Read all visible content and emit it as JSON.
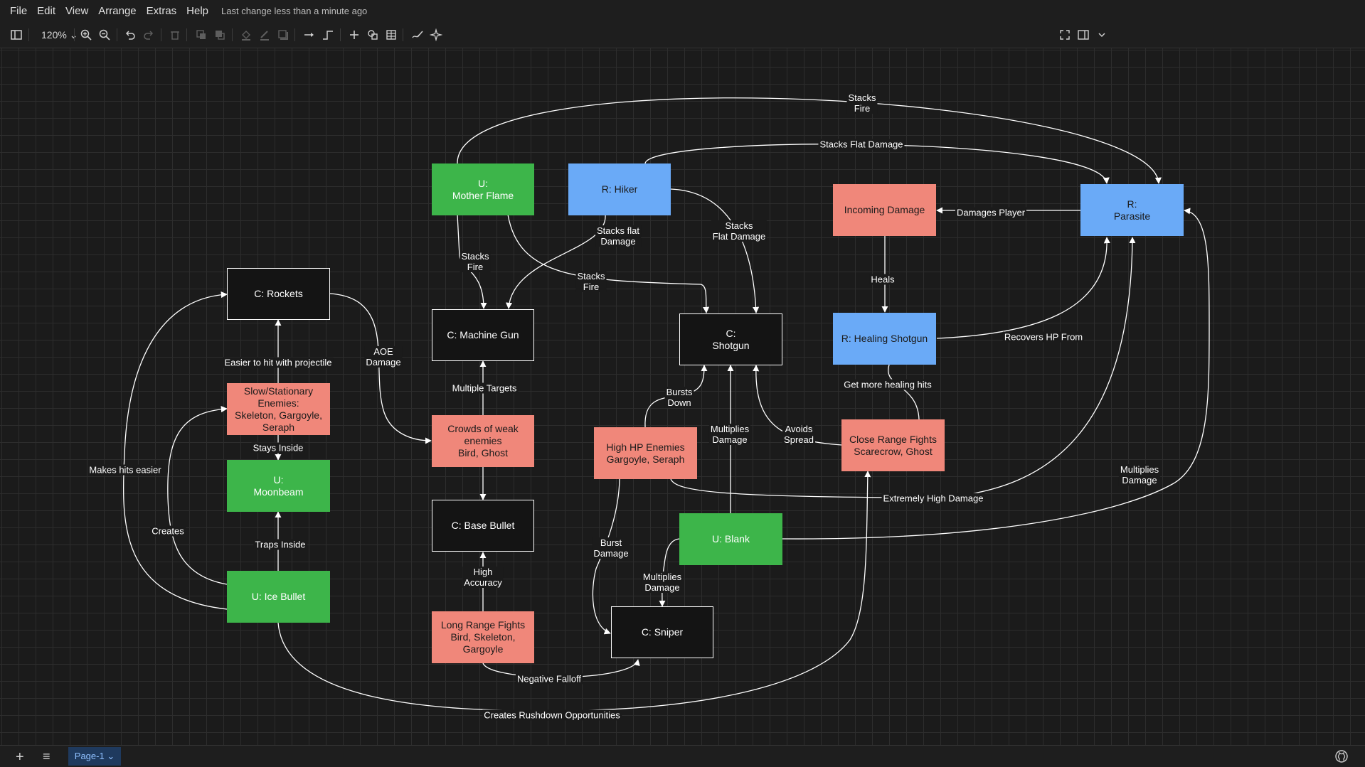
{
  "menubar": {
    "items": [
      "File",
      "Edit",
      "View",
      "Arrange",
      "Extras",
      "Help"
    ],
    "status": "Last change less than a minute ago"
  },
  "toolbar": {
    "zoom_value": "120%"
  },
  "colors": {
    "green": "#3db54a",
    "blue": "#6aaaf7",
    "salmon": "#f0877a",
    "black_node": "#141414",
    "background": "#1b1b1b"
  },
  "nodes": {
    "mother_flame": "U:\nMother Flame",
    "hiker": "R: Hiker",
    "incoming_damage": "Incoming Damage",
    "parasite": "R:\nParasite",
    "rockets": "C: Rockets",
    "machine_gun": "C: Machine Gun",
    "shotgun": "C:\nShotgun",
    "healing_shotgun": "R: Healing Shotgun",
    "slow_enemies": "Slow/Stationary\nEnemies:\nSkeleton, Gargoyle,\nSeraph",
    "crowds": "Crowds of weak\nenemies\nBird, Ghost",
    "high_hp": "High HP Enemies\nGargoyle, Seraph",
    "close_range": "Close Range Fights\nScarecrow, Ghost",
    "moonbeam": "U:\nMoonbeam",
    "base_bullet": "C: Base Bullet",
    "blank": "U: Blank",
    "ice_bullet": "U: Ice Bullet",
    "long_range": "Long Range Fights\nBird, Skeleton,\nGargoyle",
    "sniper": "C: Sniper"
  },
  "edge_labels": {
    "stacks_fire_top": "Stacks\nFire",
    "stacks_flat_damage_top": "Stacks Flat Damage",
    "stacks_fire_mf_mg": "Stacks\nFire",
    "stacks_flat_damage_hiker_mg": "Stacks flat\nDamage",
    "stacks_fire_mf_sg": "Stacks\nFire",
    "stacks_flat_damage_hiker_sg": "Stacks\nFlat Damage",
    "damages_player": "Damages Player",
    "heals": "Heals",
    "recovers_hp_from": "Recovers HP From",
    "aoe_damage": "AOE\nDamage",
    "easier_to_hit": "Easier to hit with projectile",
    "multiple_targets": "Multiple Targets",
    "get_more_healing_hits": "Get more healing hits",
    "bursts_down": "Bursts\nDown",
    "multiplies_damage_sg": "Multiplies\nDamage",
    "avoids_spread": "Avoids\nSpread",
    "stays_inside": "Stays Inside",
    "makes_hits_easier": "Makes hits easier",
    "multiplies_damage_parasite": "Multiplies\nDamage",
    "extremely_high_damage": "Extremely High Damage",
    "creates": "Creates",
    "traps_inside": "Traps Inside",
    "burst_damage": "Burst\nDamage",
    "multiplies_damage_sniper": "Multiplies\nDamage",
    "high_accuracy": "High\nAccuracy",
    "negative_falloff": "Negative Falloff",
    "creates_rushdown": "Creates Rushdown Opportunities"
  },
  "footer": {
    "page_tab": "Page-1 ⌄"
  },
  "icons": [
    "sidebar-icon",
    "zoom-in-icon",
    "zoom-out-icon",
    "undo-icon",
    "redo-icon",
    "delete-icon",
    "to-front-icon",
    "to-back-icon",
    "fill-color-icon",
    "line-color-icon",
    "shadow-icon",
    "connection-icon",
    "waypoints-icon",
    "insert-icon",
    "shapes-icon",
    "table-icon",
    "freehand-icon",
    "magic-icon",
    "fullscreen-icon",
    "format-panel-icon",
    "collapse-icon",
    "github-icon"
  ]
}
